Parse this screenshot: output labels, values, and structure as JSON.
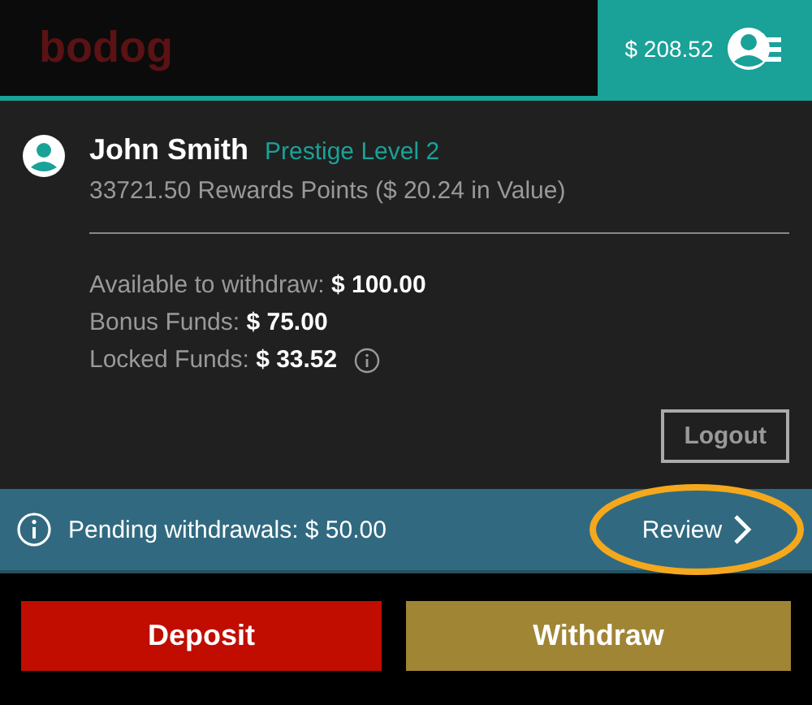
{
  "header": {
    "logo": "bodog",
    "balance": "$ 208.52"
  },
  "profile": {
    "name": "John Smith",
    "level": "Prestige Level 2",
    "points": "33721.50 Rewards Points ($ 20.24 in Value)"
  },
  "funds": [
    {
      "text": "Available to withdraw: **$ 100.00**",
      "info": false
    },
    {
      "text": "Bonus Funds: **$ 75.00**",
      "info": false
    },
    {
      "text": "Locked Funds: **$ 33.52**",
      "info": true
    }
  ],
  "logout": "Logout",
  "pending": {
    "text": "Pending withdrawals: $ 50.00",
    "action": "Review",
    "highlighted": true
  },
  "buttons": [
    {
      "label": "Deposit",
      "kind": "deposit"
    },
    {
      "label": "Withdraw",
      "kind": "withdraw"
    }
  ]
}
